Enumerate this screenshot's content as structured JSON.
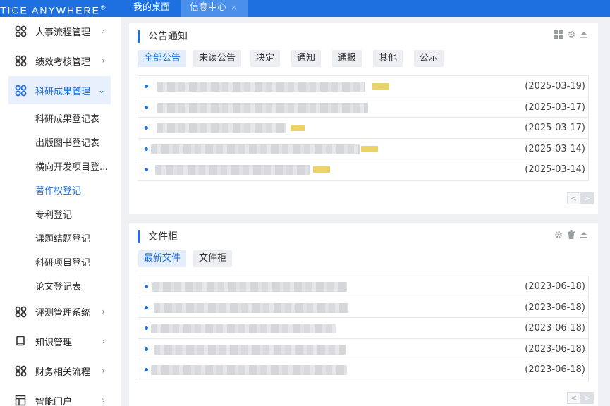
{
  "topbar": {
    "brand": "TICE ANYWHERE",
    "brand_mark": "®",
    "tabs": [
      {
        "label": "我的桌面"
      },
      {
        "label": "信息中心",
        "close": "×"
      }
    ]
  },
  "sidebar": {
    "items": [
      {
        "label": "人事流程管理",
        "icon": "cluster-icon",
        "chevron": "›"
      },
      {
        "label": "绩效考核管理",
        "icon": "cluster-icon",
        "chevron": "›"
      },
      {
        "label": "科研成果管理",
        "icon": "cluster-icon",
        "chevron": "⌄"
      },
      {
        "label": "评测管理系统",
        "icon": "cluster-icon",
        "chevron": "›"
      },
      {
        "label": "知识管理",
        "icon": "book-icon",
        "chevron": "›"
      },
      {
        "label": "财务相关流程",
        "icon": "cluster-icon",
        "chevron": "›"
      },
      {
        "label": "智能门户",
        "icon": "portal-icon",
        "chevron": "›"
      }
    ],
    "sub_items": [
      {
        "label": "科研成果登记表"
      },
      {
        "label": "出版图书登记表"
      },
      {
        "label": "横向开发项目登..."
      },
      {
        "label": "著作权登记"
      },
      {
        "label": "专利登记"
      },
      {
        "label": "课题结题登记"
      },
      {
        "label": "科研项目登记"
      },
      {
        "label": "论文登记表"
      }
    ]
  },
  "notice_panel": {
    "title": "公告通知",
    "tools": [
      "grid-icon",
      "gear-icon",
      "collapse-icon"
    ],
    "filters": [
      "全部公告",
      "未读公告",
      "决定",
      "通知",
      "通报",
      "其他",
      "公示"
    ],
    "active_filter": "全部公告",
    "rows": [
      {
        "date": "(2025-03-19)",
        "is_new": true
      },
      {
        "date": "(2025-03-17)",
        "is_new": false
      },
      {
        "date": "(2025-03-17)",
        "is_new": true
      },
      {
        "date": "(2025-03-14)",
        "is_new": true
      },
      {
        "date": "(2025-03-14)",
        "is_new": true
      }
    ],
    "pager": {
      "prev": "<",
      "next": ">"
    }
  },
  "file_panel": {
    "title": "文件柜",
    "tools": [
      "gear-icon",
      "trash-icon",
      "collapse-icon"
    ],
    "filters": [
      "最新文件",
      "文件柜"
    ],
    "active_filter": "最新文件",
    "rows": [
      {
        "date": "(2023-06-18)"
      },
      {
        "date": "(2023-06-18)"
      },
      {
        "date": "(2023-06-18)"
      },
      {
        "date": "(2023-06-18)"
      },
      {
        "date": "(2023-06-18)"
      }
    ],
    "pager": {
      "prev": "<",
      "next": ">"
    }
  },
  "colors": {
    "accent": "#1e6fe0",
    "topbar": "#1e6fe0",
    "active_bg": "#e8f0fd"
  }
}
